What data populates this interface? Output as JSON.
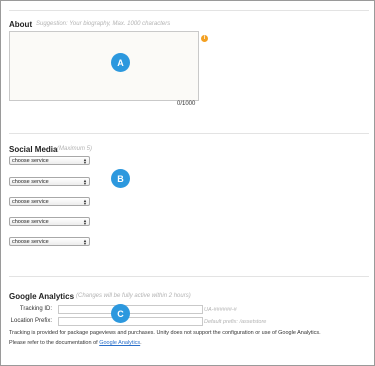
{
  "about": {
    "title": "About",
    "hint": "Suggestion: Your biography, Max. 1000 characters",
    "counter": "0/1000",
    "info_icon": "i",
    "badge": "A"
  },
  "social": {
    "title": "Social Media",
    "hint": "(Maximum 5)",
    "badge": "B",
    "selects": [
      {
        "value": "choose service"
      },
      {
        "value": "choose service"
      },
      {
        "value": "choose service"
      },
      {
        "value": "choose service"
      },
      {
        "value": "choose service"
      }
    ]
  },
  "analytics": {
    "title": "Google Analytics",
    "hint": "(Changes will be fully active within 2 hours)",
    "badge": "C",
    "tracking_label": "Tracking ID:",
    "tracking_placeholder": "UA-######-#",
    "prefix_label": "Location Prefix:",
    "prefix_hint": "Default prefix: /assetstore",
    "note_line1": "Tracking is provided for package pageviews and purchases. Unity does not support the configuration or use of Google Analytics.",
    "note_line2_prefix": "Please refer to the documentation of",
    "note_link": "Google Analytics",
    "note_line2_suffix": "."
  },
  "colors": {
    "badge": "#2c98de",
    "info": "#f3a021",
    "link": "#2a6fc9"
  }
}
